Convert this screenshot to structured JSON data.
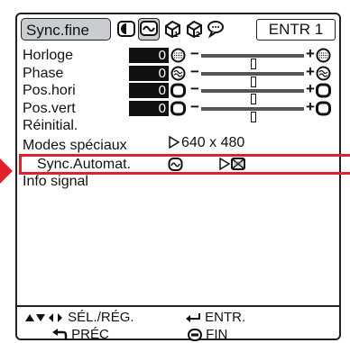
{
  "header": {
    "title": "Sync.fine",
    "tab_icons": [
      "picture-tab-icon",
      "sync-tab-icon",
      "option1-tab-icon",
      "option2-tab-icon",
      "language-tab-icon"
    ],
    "input_label": "ENTR 1"
  },
  "adjustments": [
    {
      "label": "Horloge",
      "value": "0",
      "icon": "clock-icon",
      "level": 0.5
    },
    {
      "label": "Phase",
      "value": "0",
      "icon": "phase-icon",
      "level": 0.5
    },
    {
      "label": "Pos.hori",
      "value": "0",
      "icon": "horizontal-position-icon",
      "level": 0.5
    },
    {
      "label": "Pos.vert",
      "value": "0",
      "icon": "vertical-position-icon",
      "level": 0.5
    }
  ],
  "reset_label": "Réinitial.",
  "special_modes": {
    "label": "Modes spéciaux",
    "value": "640 x 480"
  },
  "auto_sync": {
    "label": "Sync.Automat.",
    "icon": "auto-sync-icon",
    "end_icon": "off-icon"
  },
  "signal_info_label": "Info signal",
  "footer": {
    "select_adjust": "SÉL./RÉG.",
    "enter": "ENTR.",
    "back": "PRÉC",
    "end": "FIN"
  },
  "colors": {
    "highlight": "#e2202c",
    "tab_bg": "#c9ccd0"
  }
}
